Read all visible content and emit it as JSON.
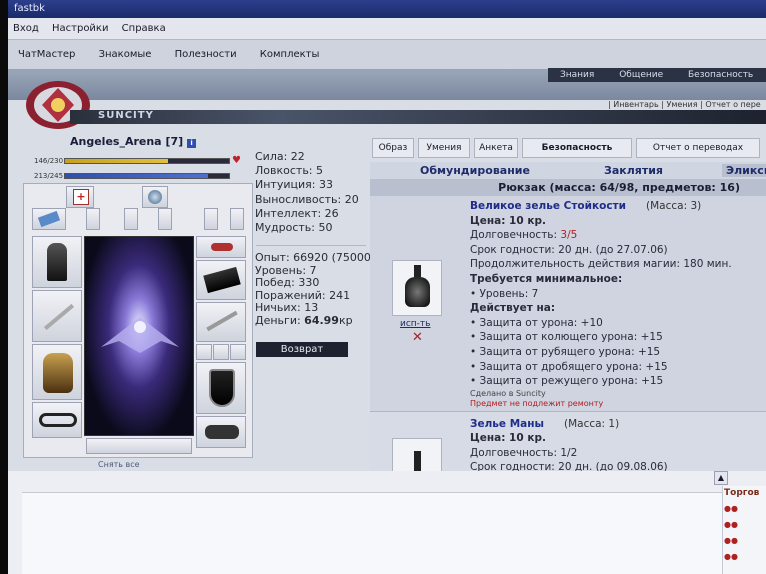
{
  "window": {
    "title": "fastbk"
  },
  "menu": [
    "Вход",
    "Настройки",
    "Справка"
  ],
  "game_nav": [
    "ЧатМастер",
    "Знакомые",
    "Полезности",
    "Комплекты"
  ],
  "top_links": [
    "Знания",
    "Общение",
    "Безопасность"
  ],
  "city": {
    "name": "SUNCITY"
  },
  "sub_nav": "| Инвентарь | Умения | Отчет о пере",
  "character": {
    "name": "Angeles_Arena",
    "level": "[7]",
    "hp_text": "146/230",
    "hp_fraction": 0.63,
    "mana_text": "213/245",
    "mana_fraction": 0.87
  },
  "stats": {
    "strength": "Сила: 22",
    "agility": "Ловкость: 5",
    "intuition": "Интуиция: 33",
    "endurance": "Выносливость: 20",
    "intellect": "Интеллект: 26",
    "wisdom": "Мудрость: 50"
  },
  "progress": {
    "exp": "Опыт: 66920 (75000)",
    "level": "Уровень: 7",
    "wins": "Побед: 330",
    "losses": "Поражений: 241",
    "draws": "Ничьих: 13",
    "money_label": "Деньги:",
    "money_value": "64.99",
    "money_unit": "кр"
  },
  "back_button": "Возврат",
  "remove_all": "Снять все",
  "tabs": [
    "Образ",
    "Умения",
    "Анкета",
    "Безопасность",
    "Отчет о переводах"
  ],
  "subtabs": [
    "Обмундирование",
    "Заклятия",
    "Эликсиры"
  ],
  "bag_header": "Рюкзак (масса: 64/98, предметов: 16)",
  "item1": {
    "name": "Великое зелье Стойкости",
    "mass": "(Масса: 3)",
    "price": "Цена: 10 кр.",
    "durability_label": "Долговечность:",
    "durability_value": "3/5",
    "expiry": "Срок годности: 20 дн. (до 27.07.06)",
    "duration": "Продолжительность действия магии: 180 мин.",
    "req_title": "Требуется минимальное:",
    "req_level": "• Уровень: 7",
    "effect_title": "Действует на:",
    "effects": [
      "• Защита от урона: +10",
      "• Защита от колющего урона: +15",
      "• Защита от рубящего урона: +15",
      "• Защита от дробящего урона: +15",
      "• Защита от режущего урона: +15"
    ],
    "made_in": "Сделано в Suncity",
    "no_repair": "Предмет не подлежит ремонту",
    "use_link": "исп-ть"
  },
  "item2": {
    "name": "Зелье Маны",
    "mass": "(Масса: 1)",
    "price": "Цена: 10 кр.",
    "durability": "Долговечность: 1/2",
    "expiry": "Срок годности: 20 дн. (до 09.08.06)"
  },
  "trade": {
    "title": "Торгов"
  },
  "colors": {
    "hp": "#d4b030",
    "mana": "#4060c0",
    "link": "#1e2c8a",
    "red": "#b02020"
  }
}
